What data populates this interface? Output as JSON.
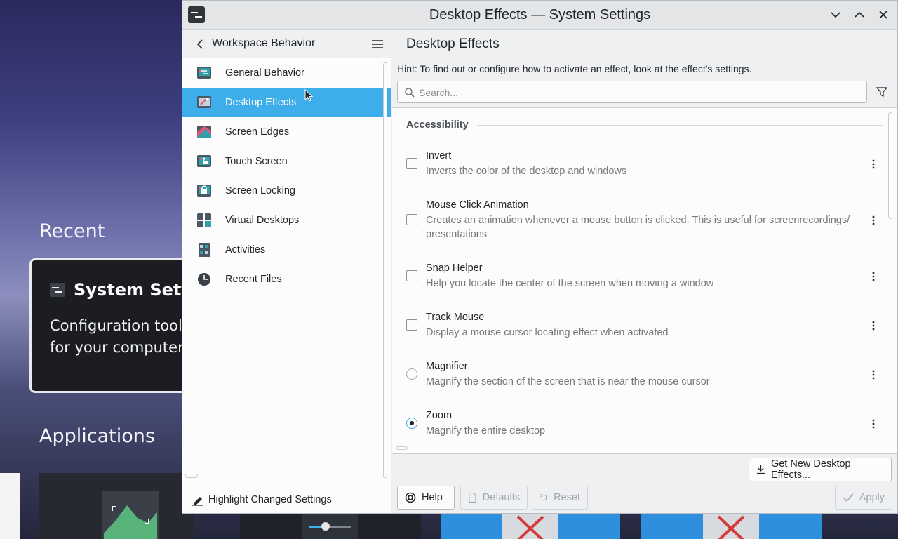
{
  "background": {
    "recent_label": "Recent",
    "applications_label": "Applications",
    "card_title": "System Setti",
    "card_desc_line1": "Configuration tool",
    "card_desc_line2": "for your computer"
  },
  "window": {
    "title": "Desktop Effects — System Settings",
    "controls": [
      "minimize-icon",
      "maximize-icon",
      "close-icon"
    ]
  },
  "sidebar": {
    "title": "Workspace Behavior",
    "items": [
      {
        "label": "General Behavior",
        "icon": "general-behavior-icon",
        "active": false
      },
      {
        "label": "Desktop Effects",
        "icon": "desktop-effects-icon",
        "active": true
      },
      {
        "label": "Screen Edges",
        "icon": "screen-edges-icon",
        "active": false
      },
      {
        "label": "Touch Screen",
        "icon": "touch-screen-icon",
        "active": false
      },
      {
        "label": "Screen Locking",
        "icon": "screen-locking-icon",
        "active": false
      },
      {
        "label": "Virtual Desktops",
        "icon": "virtual-desktops-icon",
        "active": false
      },
      {
        "label": "Activities",
        "icon": "activities-icon",
        "active": false
      },
      {
        "label": "Recent Files",
        "icon": "recent-files-icon",
        "active": false
      }
    ],
    "footer_label": "Highlight Changed Settings"
  },
  "main": {
    "title": "Desktop Effects",
    "hint": "Hint: To find out or configure how to activate an effect, look at the effect's settings.",
    "search": {
      "placeholder": "Search...",
      "value": ""
    },
    "section": "Accessibility",
    "effects": [
      {
        "name": "Invert",
        "description": "Inverts the color of the desktop and windows",
        "control": "checkbox",
        "checked": false
      },
      {
        "name": "Mouse Click Animation",
        "description": "Creates an animation whenever a mouse button is clicked. This is useful for screenrecordings/ presentations",
        "control": "checkbox",
        "checked": false
      },
      {
        "name": "Snap Helper",
        "description": "Help you locate the center of the screen when moving a window",
        "control": "checkbox",
        "checked": false
      },
      {
        "name": "Track Mouse",
        "description": "Display a mouse cursor locating effect when activated",
        "control": "checkbox",
        "checked": false
      },
      {
        "name": "Magnifier",
        "description": "Magnify the section of the screen that is near the mouse cursor",
        "control": "radio",
        "checked": false
      },
      {
        "name": "Zoom",
        "description": "Magnify the entire desktop",
        "control": "radio",
        "checked": true
      }
    ],
    "get_new_label": "Get New Desktop Effects...",
    "help_label": "Help",
    "defaults_label": "Defaults",
    "reset_label": "Reset",
    "apply_label": "Apply"
  },
  "colors": {
    "accent": "#3daee9",
    "window_bg": "#eff0f1",
    "view_bg": "#fcfcfc",
    "text": "#232629",
    "muted_text": "#72777c"
  }
}
